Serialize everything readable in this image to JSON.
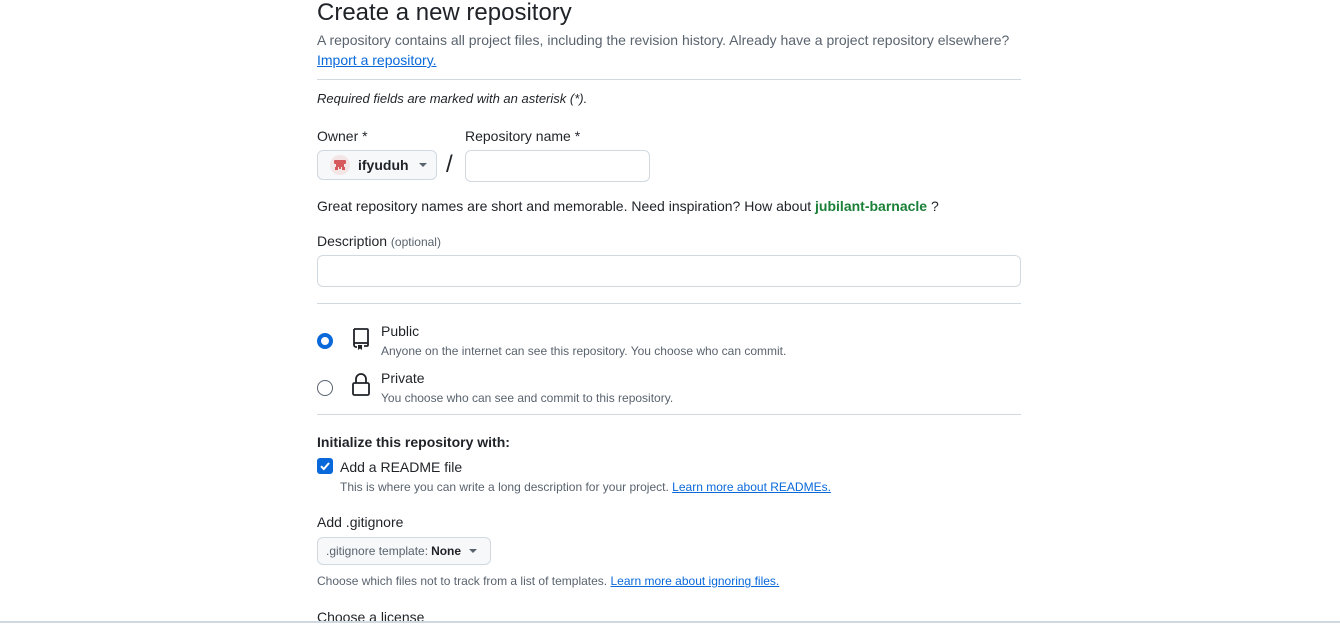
{
  "header": {
    "title": "Create a new repository",
    "subtitle": "A repository contains all project files, including the revision history. Already have a project repository elsewhere?",
    "import_link": "Import a repository."
  },
  "required_note": "Required fields are marked with an asterisk (*).",
  "owner": {
    "label": "Owner *",
    "value": "ifyuduh",
    "avatar_icon": "identicon-avatar"
  },
  "separator": "/",
  "repo_name": {
    "label": "Repository name *",
    "value": "",
    "placeholder": ""
  },
  "suggestion": {
    "prefix": "Great repository names are short and memorable. Need inspiration? How about",
    "name": "jubilant-barnacle",
    "suffix": "?"
  },
  "description": {
    "label": "Description",
    "optional": "(optional)",
    "value": ""
  },
  "visibility": {
    "options": [
      {
        "label": "Public",
        "desc": "Anyone on the internet can see this repository. You choose who can commit.",
        "selected": true,
        "icon": "repo-icon"
      },
      {
        "label": "Private",
        "desc": "You choose who can see and commit to this repository.",
        "selected": false,
        "icon": "lock-icon"
      }
    ]
  },
  "init": {
    "heading": "Initialize this repository with:",
    "readme_label": "Add a README file",
    "readme_checked": true,
    "readme_desc": "This is where you can write a long description for your project.",
    "readme_link": "Learn more about READMEs."
  },
  "gitignore": {
    "heading": "Add .gitignore",
    "button_prefix": ".gitignore template:",
    "button_value": "None",
    "desc": "Choose which files not to track from a list of templates.",
    "link": "Learn more about ignoring files."
  },
  "license": {
    "heading": "Choose a license"
  },
  "colors": {
    "accent": "#0969da",
    "suggestion_green": "#1a7f37",
    "border": "#d1d9e0",
    "muted": "#59636e"
  }
}
